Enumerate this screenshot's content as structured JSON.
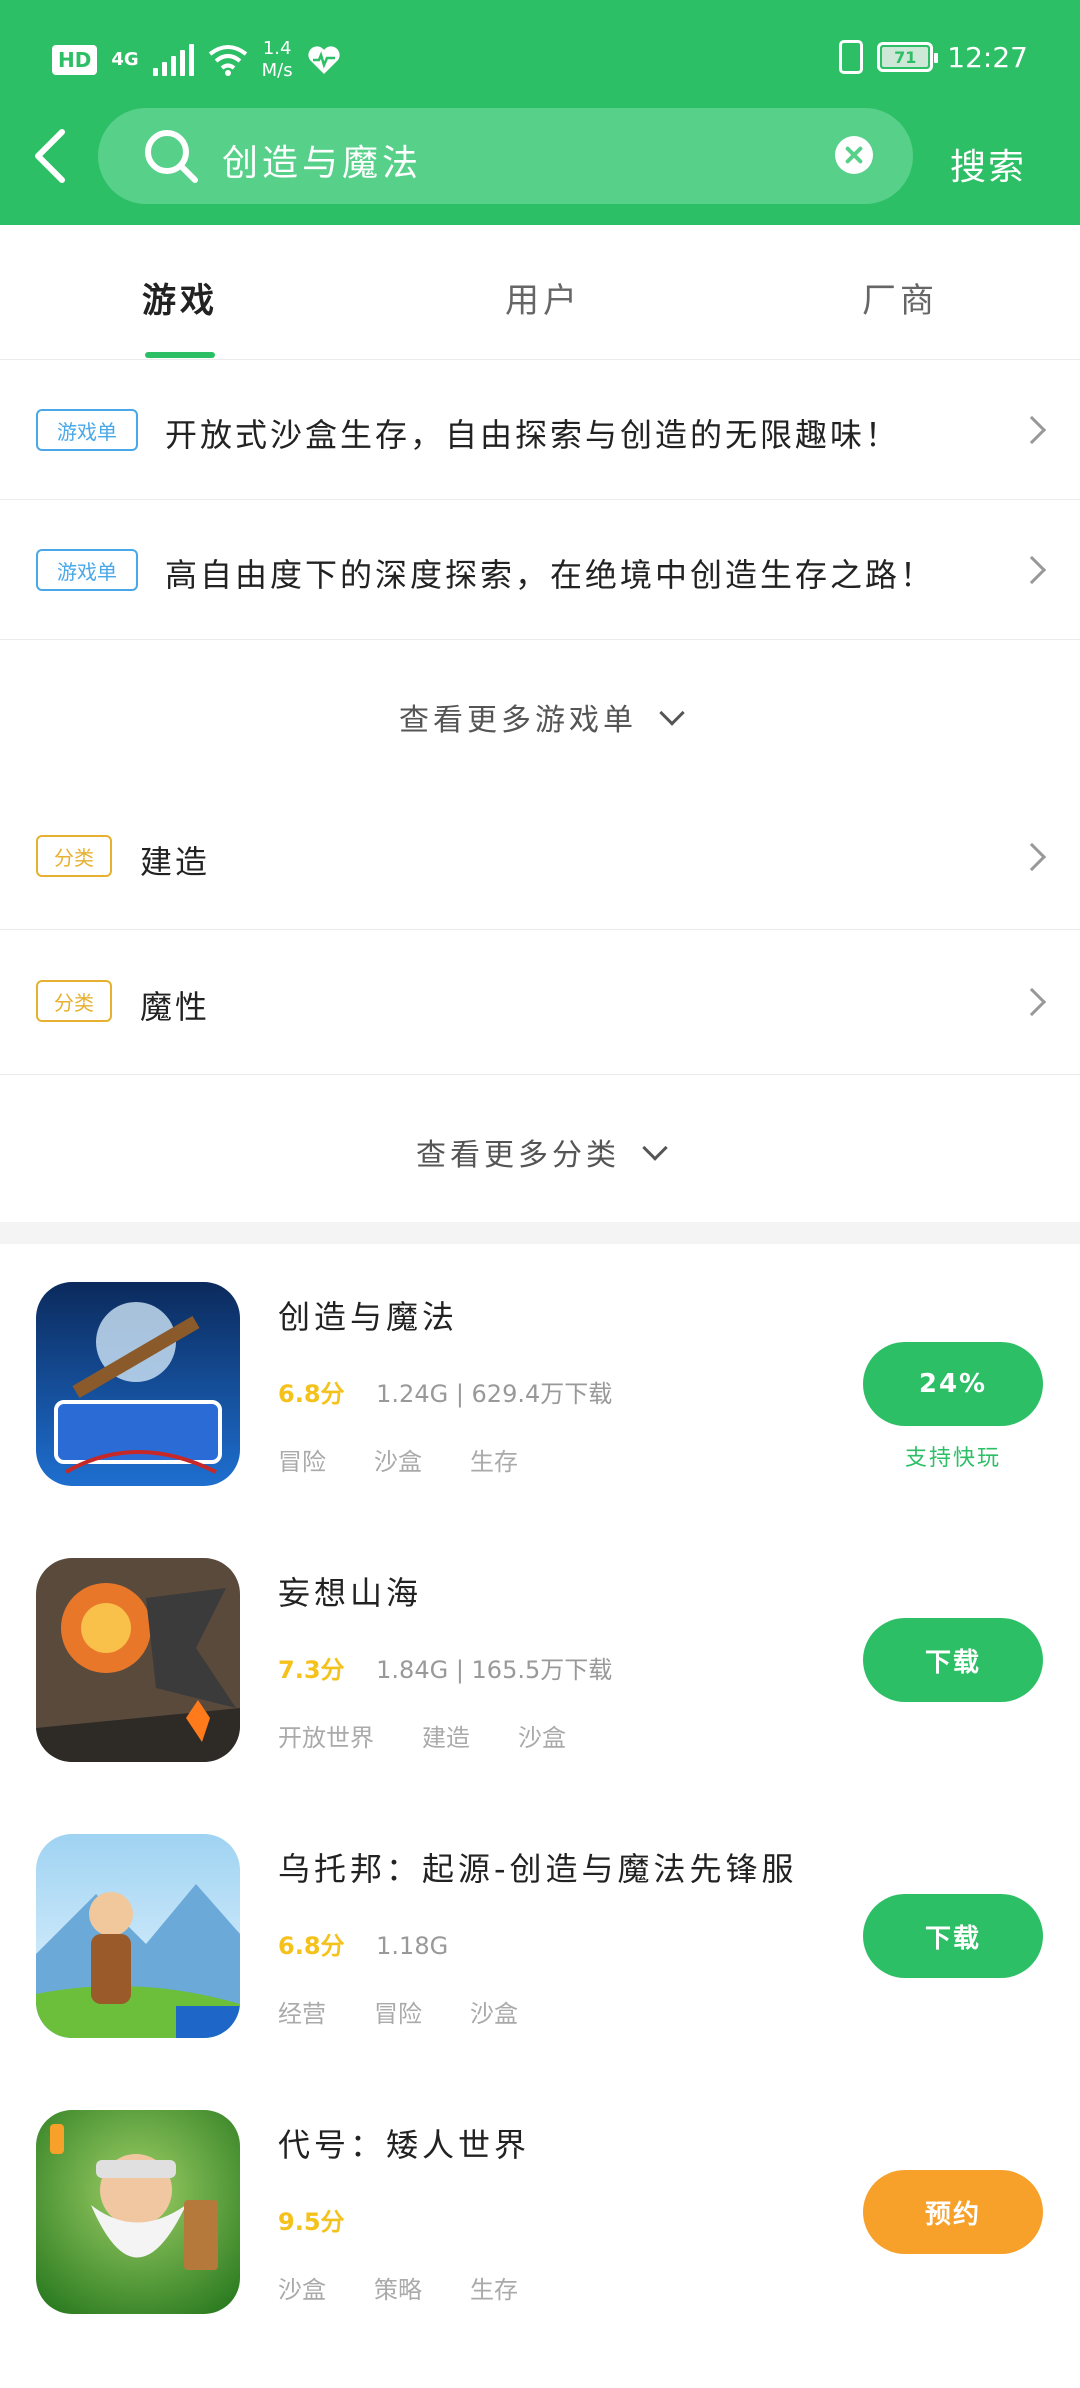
{
  "status_bar": {
    "hd": "HD",
    "network": "4G",
    "speed_value": "1.4",
    "speed_unit": "M/s",
    "battery": "71",
    "time": "12:27"
  },
  "search": {
    "query": "创造与魔法",
    "button": "搜索"
  },
  "tabs": [
    {
      "label": "游戏",
      "active": true
    },
    {
      "label": "用户",
      "active": false
    },
    {
      "label": "厂商",
      "active": false
    }
  ],
  "game_lists": [
    {
      "tag": "游戏单",
      "title": "开放式沙盒生存，自由探索与创造的无限趣味！"
    },
    {
      "tag": "游戏单",
      "title": "高自由度下的深度探索，在绝境中创造生存之路！"
    }
  ],
  "more_game_lists": "查看更多游戏单",
  "categories": [
    {
      "tag": "分类",
      "title": "建造"
    },
    {
      "tag": "分类",
      "title": "魔性"
    }
  ],
  "more_categories": "查看更多分类",
  "games": [
    {
      "name": "创造与魔法",
      "score": "6.8分",
      "meta": "1.24G | 629.4万下载",
      "tags": [
        "冒险",
        "沙盒",
        "生存"
      ],
      "button": "24%",
      "button_sub": "支持快玩",
      "button_color": "#2dbf66",
      "icon": "creation-magic-game-icon"
    },
    {
      "name": "妄想山海",
      "score": "7.3分",
      "meta": "1.84G | 165.5万下载",
      "tags": [
        "开放世界",
        "建造",
        "沙盒"
      ],
      "button": "下载",
      "button_sub": "",
      "button_color": "#2dbf66",
      "icon": "dragon-game-icon"
    },
    {
      "name": "乌托邦：起源-创造与魔法先锋服",
      "score": "6.8分",
      "meta": "1.18G",
      "tags": [
        "经营",
        "冒险",
        "沙盒"
      ],
      "button": "下载",
      "button_sub": "",
      "button_color": "#2dbf66",
      "icon": "utopia-game-icon"
    },
    {
      "name": "代号：矮人世界",
      "score": "9.5分",
      "meta": "",
      "tags": [
        "沙盒",
        "策略",
        "生存"
      ],
      "button": "预约",
      "button_sub": "",
      "button_color": "#f7a12a",
      "icon": "dwarf-game-icon"
    }
  ]
}
